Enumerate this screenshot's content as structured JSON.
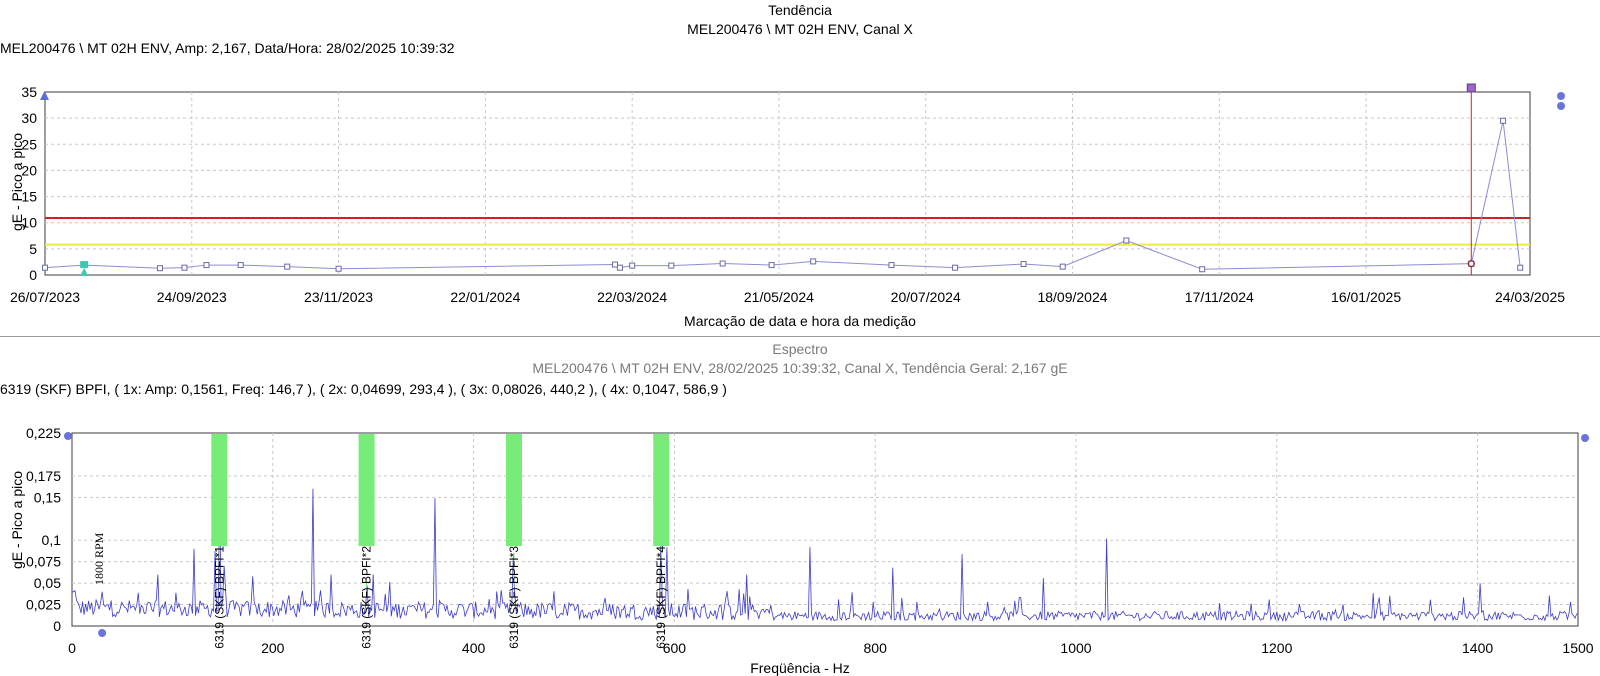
{
  "trend": {
    "title": "Tendência",
    "subtitle": "MEL200476 \\ MT 02H ENV, Canal X",
    "cursor_info": "MEL200476 \\ MT 02H ENV, Amp: 2,167, Data/Hora: 28/02/2025 10:39:32",
    "ylabel": "gE - Pico a pico",
    "xlabel": "Marcação de data e hora da medição"
  },
  "spectrum": {
    "title": "Espectro",
    "subtitle": "MEL200476 \\ MT 02H ENV, 28/02/2025 10:39:32, Canal X, Tendência Geral: 2,167 gE",
    "cursor_info": "6319 (SKF) BPFI, ( 1x: Amp: 0,1561, Freq: 146,7 ), ( 2x: 0,04699, 293,4 ), ( 3x: 0,08026, 440,2 ), ( 4x: 0,1047, 586,9 )",
    "ylabel": "gE - Pico a pico",
    "xlabel": "Freqüência - Hz",
    "rpm_label": "1800 RPM"
  },
  "chart_data": [
    {
      "type": "line",
      "title": "Tendência",
      "xlabel": "Marcação de data e hora da medição",
      "ylabel": "gE - Pico a pico",
      "x_ticks": [
        "26/07/2023",
        "24/09/2023",
        "23/11/2023",
        "22/01/2024",
        "22/03/2024",
        "21/05/2024",
        "20/07/2024",
        "18/09/2024",
        "17/11/2024",
        "16/01/2025",
        "24/03/2025"
      ],
      "y_ticks": [
        "0",
        "5",
        "10",
        "15",
        "20",
        "25",
        "30",
        "35"
      ],
      "ylim": [
        0,
        35
      ],
      "xlim_days": [
        0,
        607
      ],
      "alarm_levels": [
        {
          "level": "alert",
          "value": 5.8,
          "color": "#ecec3c"
        },
        {
          "level": "danger",
          "value": 10.9,
          "color": "#c8242a"
        }
      ],
      "cursor_date": "28/02/2025",
      "cursor_value": 2.167,
      "series": [
        {
          "color": "#8c8cd6",
          "points": [
            {
              "date": "26/07/2023",
              "value": 1.4
            },
            {
              "date": "11/08/2023",
              "value": 1.9
            },
            {
              "date": "11/09/2023",
              "value": 1.3
            },
            {
              "date": "21/09/2023",
              "value": 1.4
            },
            {
              "date": "30/09/2023",
              "value": 1.9
            },
            {
              "date": "14/10/2023",
              "value": 1.9
            },
            {
              "date": "02/11/2023",
              "value": 1.6
            },
            {
              "date": "23/11/2023",
              "value": 1.2
            },
            {
              "date": "15/03/2024",
              "value": 2.0
            },
            {
              "date": "17/03/2024",
              "value": 1.4
            },
            {
              "date": "22/03/2024",
              "value": 1.8
            },
            {
              "date": "07/04/2024",
              "value": 1.8
            },
            {
              "date": "28/04/2024",
              "value": 2.2
            },
            {
              "date": "18/05/2024",
              "value": 1.9
            },
            {
              "date": "04/06/2024",
              "value": 2.6
            },
            {
              "date": "06/07/2024",
              "value": 1.9
            },
            {
              "date": "01/08/2024",
              "value": 1.4
            },
            {
              "date": "29/08/2024",
              "value": 2.1
            },
            {
              "date": "14/09/2024",
              "value": 1.6
            },
            {
              "date": "10/10/2024",
              "value": 6.6
            },
            {
              "date": "10/11/2024",
              "value": 1.1
            },
            {
              "date": "28/02/2025",
              "value": 2.167
            },
            {
              "date": "13/03/2025",
              "value": 29.5
            },
            {
              "date": "20/03/2025",
              "value": 1.4
            }
          ]
        }
      ]
    },
    {
      "type": "line",
      "title": "Espectro",
      "xlabel": "Freqüência - Hz",
      "ylabel": "gE - Pico a pico",
      "x_ticks": [
        "0",
        "200",
        "400",
        "600",
        "800",
        "1000",
        "1200",
        "1400",
        "1500"
      ],
      "y_ticks": [
        "0",
        "0,025",
        "0,05",
        "0,075",
        "0,1",
        "0,15",
        "0,175",
        "0,225"
      ],
      "xlim": [
        0,
        1500
      ],
      "ylim": [
        0,
        0.225
      ],
      "fault_markers": [
        {
          "label": "6319 (SKF) BPFI*1",
          "freq": 146.7,
          "amp": 0.1561
        },
        {
          "label": "6319 (SKF) BPFI*2",
          "freq": 293.4,
          "amp": 0.04699
        },
        {
          "label": "6319 (SKF) BPFI*3",
          "freq": 440.2,
          "amp": 0.08026
        },
        {
          "label": "6319 (SKF) BPFI*4",
          "freq": 586.9,
          "amp": 0.1047
        }
      ],
      "rpm_marker": {
        "label": "1800 RPM",
        "freq": 30
      },
      "peaks": [
        {
          "freq": 30,
          "amp": 0.04
        },
        {
          "freq": 85,
          "amp": 0.06
        },
        {
          "freq": 122,
          "amp": 0.09
        },
        {
          "freq": 143,
          "amp": 0.088
        },
        {
          "freq": 146.7,
          "amp": 0.1561
        },
        {
          "freq": 152,
          "amp": 0.07
        },
        {
          "freq": 180,
          "amp": 0.058
        },
        {
          "freq": 240,
          "amp": 0.16
        },
        {
          "freq": 258,
          "amp": 0.06
        },
        {
          "freq": 293.4,
          "amp": 0.04699
        },
        {
          "freq": 300,
          "amp": 0.06
        },
        {
          "freq": 362,
          "amp": 0.149
        },
        {
          "freq": 440.2,
          "amp": 0.08026
        },
        {
          "freq": 586.9,
          "amp": 0.1047
        },
        {
          "freq": 592,
          "amp": 0.092
        },
        {
          "freq": 672,
          "amp": 0.06
        },
        {
          "freq": 735,
          "amp": 0.092
        },
        {
          "freq": 818,
          "amp": 0.068
        },
        {
          "freq": 886,
          "amp": 0.084
        },
        {
          "freq": 968,
          "amp": 0.056
        },
        {
          "freq": 1030,
          "amp": 0.102
        },
        {
          "freq": 1402,
          "amp": 0.05
        }
      ],
      "series": [
        {
          "color": "#3c3cc8",
          "style": "dense spectrum line"
        }
      ]
    }
  ]
}
